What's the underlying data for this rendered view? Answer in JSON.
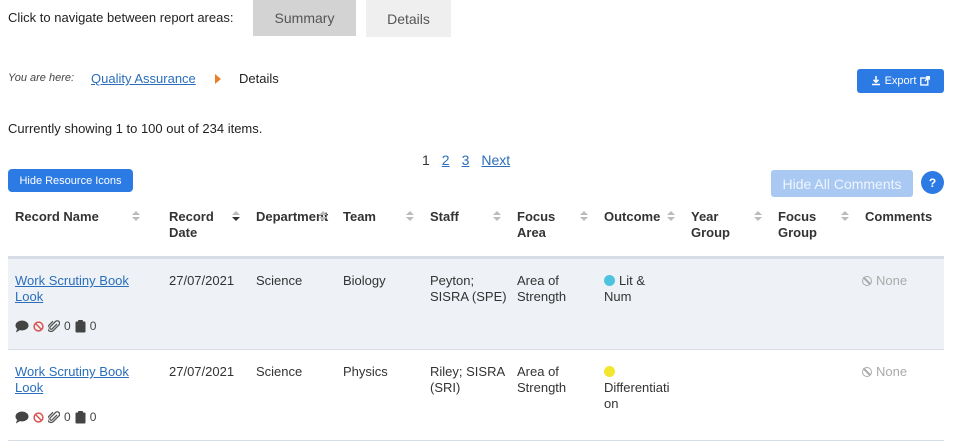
{
  "nav": {
    "label": "Click to navigate between report areas:",
    "tabs": [
      {
        "label": "Summary"
      },
      {
        "label": "Details"
      }
    ]
  },
  "breadcrumb": {
    "prefix": "You are here:",
    "link": "Quality Assurance",
    "current": "Details"
  },
  "export": {
    "label": "Export"
  },
  "status": {
    "showing": "Currently showing 1 to 100 out of 234 items."
  },
  "pagination": {
    "current": "1",
    "pages": [
      "2",
      "3"
    ],
    "next": "Next"
  },
  "buttons": {
    "hide_resource_icons": "Hide Resource Icons",
    "hide_all_comments": "Hide All Comments",
    "help": "?"
  },
  "table": {
    "headers": {
      "record_name": "Record Name",
      "record_date_1": "Record",
      "record_date_2": "Date",
      "department": "Department",
      "team": "Team",
      "staff": "Staff",
      "focus_area_1": "Focus",
      "focus_area_2": "Area",
      "outcome": "Outcome",
      "year_group_1": "Year",
      "year_group_2": "Group",
      "focus_group_1": "Focus",
      "focus_group_2": "Group",
      "comments": "Comments"
    },
    "rows": [
      {
        "record_name_1": "Work Scrutiny  Book",
        "record_name_2": "Look",
        "record_date": "27/07/2021",
        "department": "Science",
        "team": "Biology",
        "staff_1": "Peyton;",
        "staff_2": "SISRA (SPE)",
        "focus_area_1": "Area of",
        "focus_area_2": "Strength",
        "outcome_1": "Lit &",
        "outcome_2": "Num",
        "outcome_color": "#4ec3e0",
        "comments": "None",
        "attachments": "0",
        "clipboards": "0"
      },
      {
        "record_name_1": "Work Scrutiny  Book",
        "record_name_2": "Look",
        "record_date": "27/07/2021",
        "department": "Science",
        "team": "Physics",
        "staff_1": "Riley; SISRA",
        "staff_2": "(SRI)",
        "focus_area_1": "Area of",
        "focus_area_2": "Strength",
        "outcome_1": "Differentiati",
        "outcome_2": "on",
        "outcome_color": "#f2e630",
        "comments": "None",
        "attachments": "0",
        "clipboards": "0"
      }
    ]
  },
  "colors": {
    "primary": "#2c7be5",
    "link": "#2a6ebb",
    "accent_arrow": "#e8802a",
    "row_alt": "#eef2f6"
  }
}
